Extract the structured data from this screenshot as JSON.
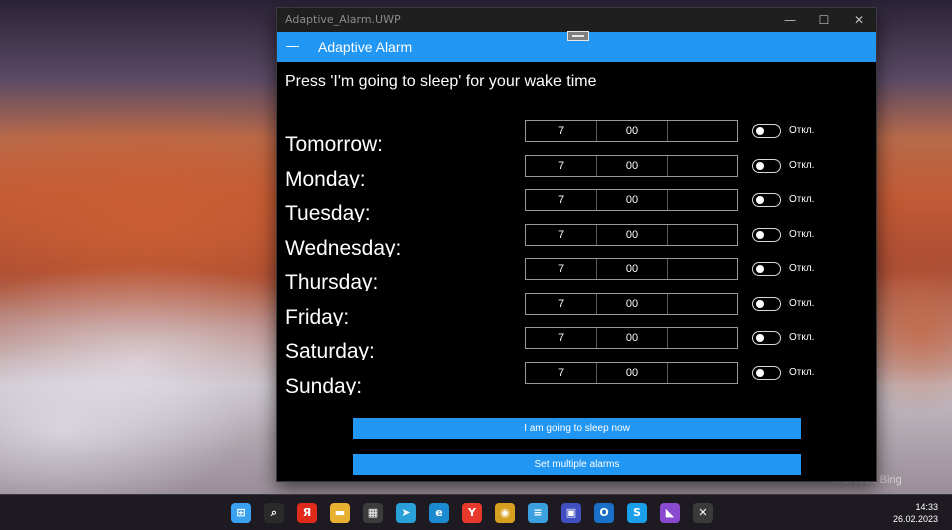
{
  "wallpaper": {
    "watermark": "Microsoft Bing"
  },
  "window": {
    "title": "Adaptive_Alarm.UWP",
    "minimize_glyph": "—",
    "maximize_glyph": "☐",
    "close_glyph": "✕"
  },
  "appbar": {
    "title": "Adaptive Alarm",
    "menu_icon": "hamburger-icon"
  },
  "instruction": "Press 'I'm going to sleep' for your wake time",
  "alarms": [
    {
      "day": "Tomorrow:",
      "hour": "7",
      "minute": "00",
      "extra": "",
      "toggle_state": "Откл."
    },
    {
      "day": "Monday:",
      "hour": "7",
      "minute": "00",
      "extra": "",
      "toggle_state": "Откл."
    },
    {
      "day": "Tuesday:",
      "hour": "7",
      "minute": "00",
      "extra": "",
      "toggle_state": "Откл."
    },
    {
      "day": "Wednesday:",
      "hour": "7",
      "minute": "00",
      "extra": "",
      "toggle_state": "Откл."
    },
    {
      "day": "Thursday:",
      "hour": "7",
      "minute": "00",
      "extra": "",
      "toggle_state": "Откл."
    },
    {
      "day": "Friday:",
      "hour": "7",
      "minute": "00",
      "extra": "",
      "toggle_state": "Откл."
    },
    {
      "day": "Saturday:",
      "hour": "7",
      "minute": "00",
      "extra": "",
      "toggle_state": "Откл."
    },
    {
      "day": "Sunday:",
      "hour": "7",
      "minute": "00",
      "extra": "",
      "toggle_state": "Откл."
    }
  ],
  "buttons": {
    "sleep_now": "I am going to sleep now",
    "set_multiple": "Set multiple alarms"
  },
  "taskbar": {
    "icons": [
      {
        "name": "start-icon",
        "glyph": "⊞",
        "color": "#3aa0f0"
      },
      {
        "name": "search-icon",
        "glyph": "⌕",
        "color": "#2a2a2a"
      },
      {
        "name": "yandex-icon",
        "glyph": "Я",
        "color": "#e02a1a"
      },
      {
        "name": "file-explorer-icon",
        "glyph": "▬",
        "color": "#e8b030"
      },
      {
        "name": "store-icon",
        "glyph": "▦",
        "color": "#3c3c3c"
      },
      {
        "name": "telegram-icon",
        "glyph": "➤",
        "color": "#2aa0d8"
      },
      {
        "name": "edge-icon",
        "glyph": "e",
        "color": "#1c8ad0"
      },
      {
        "name": "yandex-browser-icon",
        "glyph": "Y",
        "color": "#e83a2a"
      },
      {
        "name": "chrome-icon",
        "glyph": "◉",
        "color": "#d8a020"
      },
      {
        "name": "notepad-icon",
        "glyph": "≡",
        "color": "#3aa0e0"
      },
      {
        "name": "floppy-icon",
        "glyph": "▣",
        "color": "#4050c0"
      },
      {
        "name": "outlook-icon",
        "glyph": "O",
        "color": "#1a70c8"
      },
      {
        "name": "skype-icon",
        "glyph": "S",
        "color": "#1aa0e8"
      },
      {
        "name": "visual-studio-icon",
        "glyph": "◣",
        "color": "#8a4ad0"
      },
      {
        "name": "xamarin-icon",
        "glyph": "✕",
        "color": "#3a3a3a"
      }
    ],
    "time": "14:33",
    "date": "26.02.2023"
  }
}
